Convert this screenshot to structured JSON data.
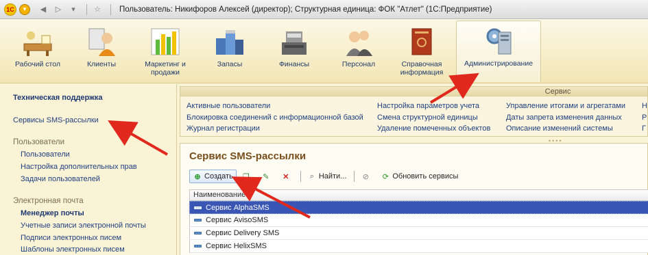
{
  "titlebar": {
    "logo": "1С",
    "title": "Пользователь: Никифоров Алексей (директор);  Структурная единица: ФОК \"Атлет\"  (1С:Предприятие)"
  },
  "sections": [
    {
      "label": "Рабочий стол",
      "icon": "desk-icon"
    },
    {
      "label": "Клиенты",
      "icon": "clients-icon"
    },
    {
      "label": "Маркетинг и продажи",
      "icon": "marketing-icon"
    },
    {
      "label": "Запасы",
      "icon": "stock-icon"
    },
    {
      "label": "Финансы",
      "icon": "cash-register-icon"
    },
    {
      "label": "Персонал",
      "icon": "staff-icon"
    },
    {
      "label": "Справочная информация",
      "icon": "book-icon"
    },
    {
      "label": "Администрирование",
      "icon": "admin-icon"
    }
  ],
  "left_panel": {
    "support": "Техническая поддержка",
    "sms": "Сервисы SMS-рассылки",
    "users_group": "Пользователи",
    "users": "Пользователи",
    "rights": "Настройка дополнительных прав",
    "user_tasks": "Задачи пользователей",
    "email_group": "Электронная почта",
    "mail_manager": "Менеджер почты",
    "accounts": "Учетные записи электронной почты",
    "signatures": "Подписи электронных писем",
    "templates": "Шаблоны электронных писем"
  },
  "service_panel": {
    "header": "Сервис",
    "col1": [
      "Активные пользователи",
      "Блокировка соединений с информационной базой",
      "Журнал регистрации"
    ],
    "col2": [
      "Настройка параметров учета",
      "Смена структурной единицы",
      "Удаление помеченных объектов"
    ],
    "col3": [
      "Управление итогами и агрегатами",
      "Даты запрета изменения данных",
      "Описание изменений системы"
    ],
    "col4": [
      "Н",
      "Р",
      "Г"
    ]
  },
  "main": {
    "title": "Сервис SMS-рассылки",
    "toolbar": {
      "create": "Создать",
      "find": "Найти...",
      "refresh": "Обновить сервисы"
    },
    "grid_header": "Наименование",
    "rows": [
      "Сервис AlphaSMS",
      "Сервис AvisoSMS",
      "Сервис Delivery SMS",
      "Сервис HelixSMS"
    ]
  }
}
